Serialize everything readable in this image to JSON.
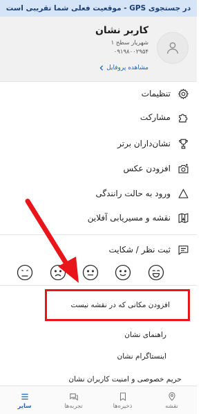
{
  "banner": {
    "text": "در جستجوی GPS - موقعیت فعلی شما تقریبی است"
  },
  "profile": {
    "name": "کاربر نشان",
    "city": "شهریار سطح ۱",
    "phone": "۰۹۱۹۸۰۰۲۹۵۴",
    "view_profile": "مشاهده پروفایل"
  },
  "menu": {
    "items": [
      {
        "label": "تنظیمات",
        "icon": "gear-icon"
      },
      {
        "label": "مشارکت",
        "icon": "puzzle-icon"
      },
      {
        "label": "نشان‌داران برتر",
        "icon": "trophy-icon"
      },
      {
        "label": "افزودن عکس",
        "icon": "add-photo-icon"
      },
      {
        "label": "ورود به حالت رانندگی",
        "icon": "navigation-icon"
      },
      {
        "label": "نقشه و مسیریابی آفلاین",
        "icon": "offline-map-icon"
      }
    ],
    "feedback": {
      "label": "ثبت نظر / شکایت",
      "icon": "feedback-icon"
    }
  },
  "faces": [
    "very-sad-face-icon",
    "sad-face-icon",
    "neutral-face-icon",
    "smile-face-icon",
    "happy-face-icon"
  ],
  "links": {
    "add_missing_place": "افزودن مکانی که در نقشه نیست",
    "guide": "راهنمای نشان",
    "instagram": "اینستاگرام نشان",
    "privacy": "حریم خصوصی و امنیت کاربران نشان"
  },
  "bottom_nav": [
    {
      "label": "نقشه",
      "icon": "map-pin-icon",
      "active": false
    },
    {
      "label": "ذخیره‌ها",
      "icon": "bookmark-icon",
      "active": false
    },
    {
      "label": "تجربه‌ها",
      "icon": "chat-icon",
      "active": false
    },
    {
      "label": "سایر",
      "icon": "menu-icon",
      "active": true
    }
  ],
  "colors": {
    "accent": "#1565c0",
    "highlight": "#e8161a",
    "banner_bg": "#d6e4f7"
  }
}
